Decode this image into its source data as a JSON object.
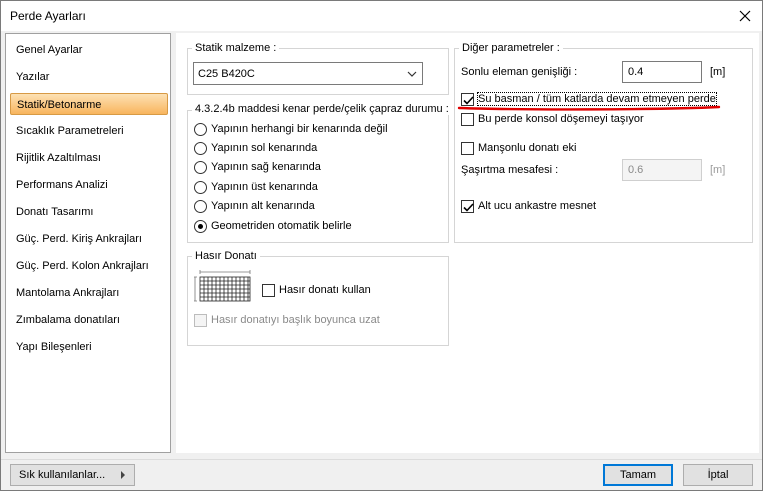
{
  "window": {
    "title": "Perde Ayarları"
  },
  "sidebar": {
    "items": [
      {
        "label": "Genel Ayarlar"
      },
      {
        "label": "Yazılar"
      },
      {
        "label": "Statik/Betonarme"
      },
      {
        "label": "Sıcaklık Parametreleri"
      },
      {
        "label": "Rijitlik Azaltılması"
      },
      {
        "label": "Performans Analizi"
      },
      {
        "label": "Donatı Tasarımı"
      },
      {
        "label": "Güç. Perd. Kiriş Ankrajları"
      },
      {
        "label": "Güç. Perd. Kolon Ankrajları"
      },
      {
        "label": "Mantolama Ankrajları"
      },
      {
        "label": "Zımbalama donatıları"
      },
      {
        "label": "Yapı Bileşenleri"
      }
    ],
    "active_index": 2
  },
  "statik": {
    "label": "Statik malzeme :",
    "value": "C25 B420C"
  },
  "kenar": {
    "label": "4.3.2.4b maddesi kenar perde/çelik çapraz durumu :",
    "options": [
      {
        "label": "Yapının herhangi bir kenarında değil"
      },
      {
        "label": "Yapının sol kenarında"
      },
      {
        "label": "Yapının sağ kenarında"
      },
      {
        "label": "Yapının üst kenarında"
      },
      {
        "label": "Yapının alt kenarında"
      },
      {
        "label": "Geometriden otomatik belirle"
      }
    ],
    "selected_index": 5
  },
  "hasir": {
    "label": "Hasır Donatı",
    "use_label": "Hasır donatı kullan",
    "extend_label": "Hasır donatıyı başlık boyunca uzat"
  },
  "diger": {
    "label": "Diğer parametreler :",
    "sonlu_label": "Sonlu eleman genişliği :",
    "sonlu_value": "0.4",
    "sonlu_unit": "[m]",
    "bodrum_label": "Su basman / tüm katlarda devam etmeyen perde",
    "konsol_label": "Bu perde konsol döşemeyi taşıyor",
    "manson_label": "Manşonlu donatı eki",
    "sasirtma_label": "Şaşırtma mesafesi :",
    "sasirtma_value": "0.6",
    "sasirtma_unit": "[m]",
    "ankastre_label": "Alt ucu ankastre mesnet"
  },
  "footer": {
    "favorites_label": "Sık kullanılanlar...",
    "ok_label": "Tamam",
    "cancel_label": "İptal"
  },
  "colors": {
    "accent": "#0078d7",
    "active_tab_top": "#fde1b4",
    "active_tab_bottom": "#f8b55e",
    "annotation_red": "#e00000"
  }
}
